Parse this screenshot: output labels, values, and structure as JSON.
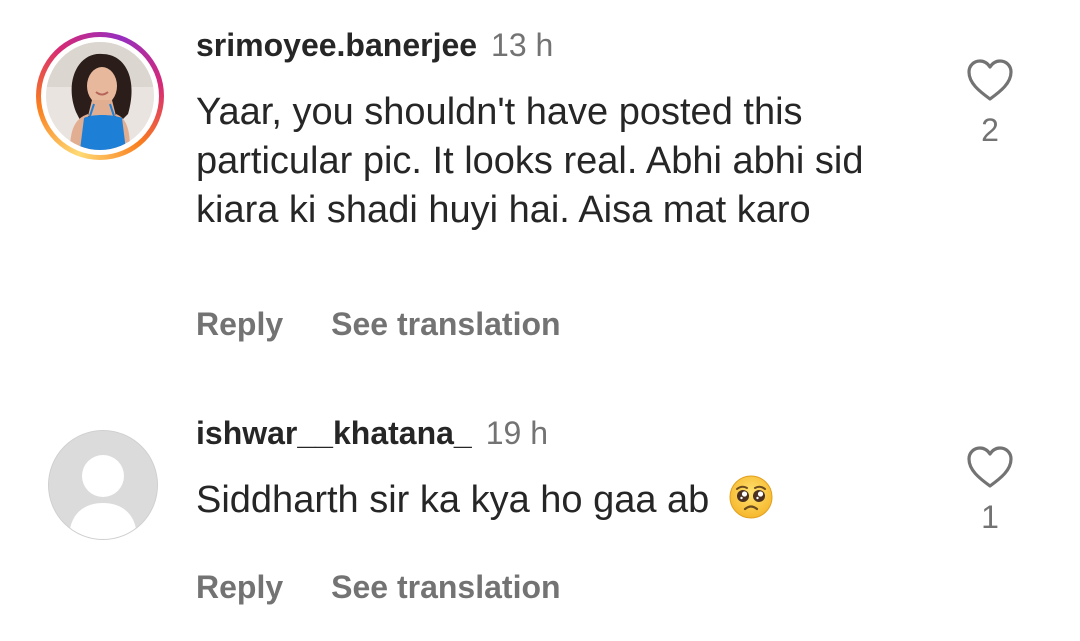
{
  "comments": [
    {
      "username": "srimoyee.banerjee",
      "time": "13 h",
      "text": "Yaar, you shouldn't have posted this particular pic. It looks real. Abhi abhi sid kiara ki shadi huyi hai. Aisa mat karo",
      "reply_label": "Reply",
      "translate_label": "See translation",
      "likes": "2",
      "avatar": "profile-photo-with-story-ring"
    },
    {
      "username": "ishwar__khatana_",
      "time": "19 h",
      "text": "Siddharth sir ka kya ho gaa ab",
      "emoji": "pleading-face-icon",
      "reply_label": "Reply",
      "translate_label": "See translation",
      "likes": "1",
      "avatar": "default-avatar"
    }
  ],
  "colors": {
    "text": "#262626",
    "secondary": "#737373",
    "heart_outline": "#737373",
    "default_avatar": "#dbdbdb"
  }
}
